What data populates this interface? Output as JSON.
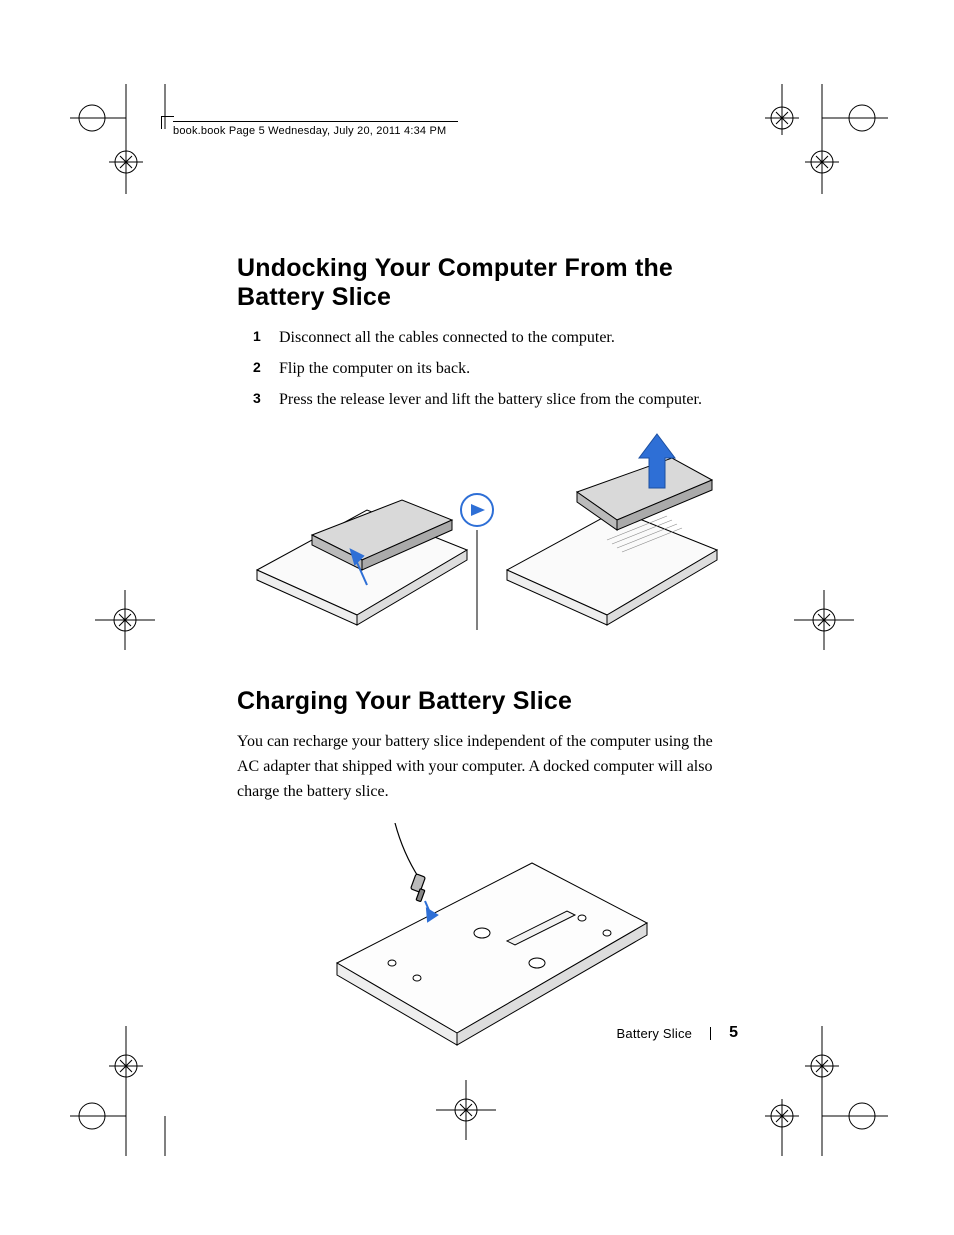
{
  "running_head": "book.book  Page 5  Wednesday, July 20, 2011  4:34 PM",
  "section1": {
    "title": "Undocking Your Computer From the Battery Slice",
    "steps": [
      "Disconnect all the cables connected to the computer.",
      "Flip the computer on its back.",
      "Press the release lever and lift the battery slice from the computer."
    ]
  },
  "section2": {
    "title": "Charging Your Battery Slice",
    "body": "You can recharge your battery slice independent of the computer using the AC adapter that shipped with your computer. A docked computer will also charge the battery slice."
  },
  "footer": {
    "section_name": "Battery Slice",
    "page_number": "5"
  }
}
